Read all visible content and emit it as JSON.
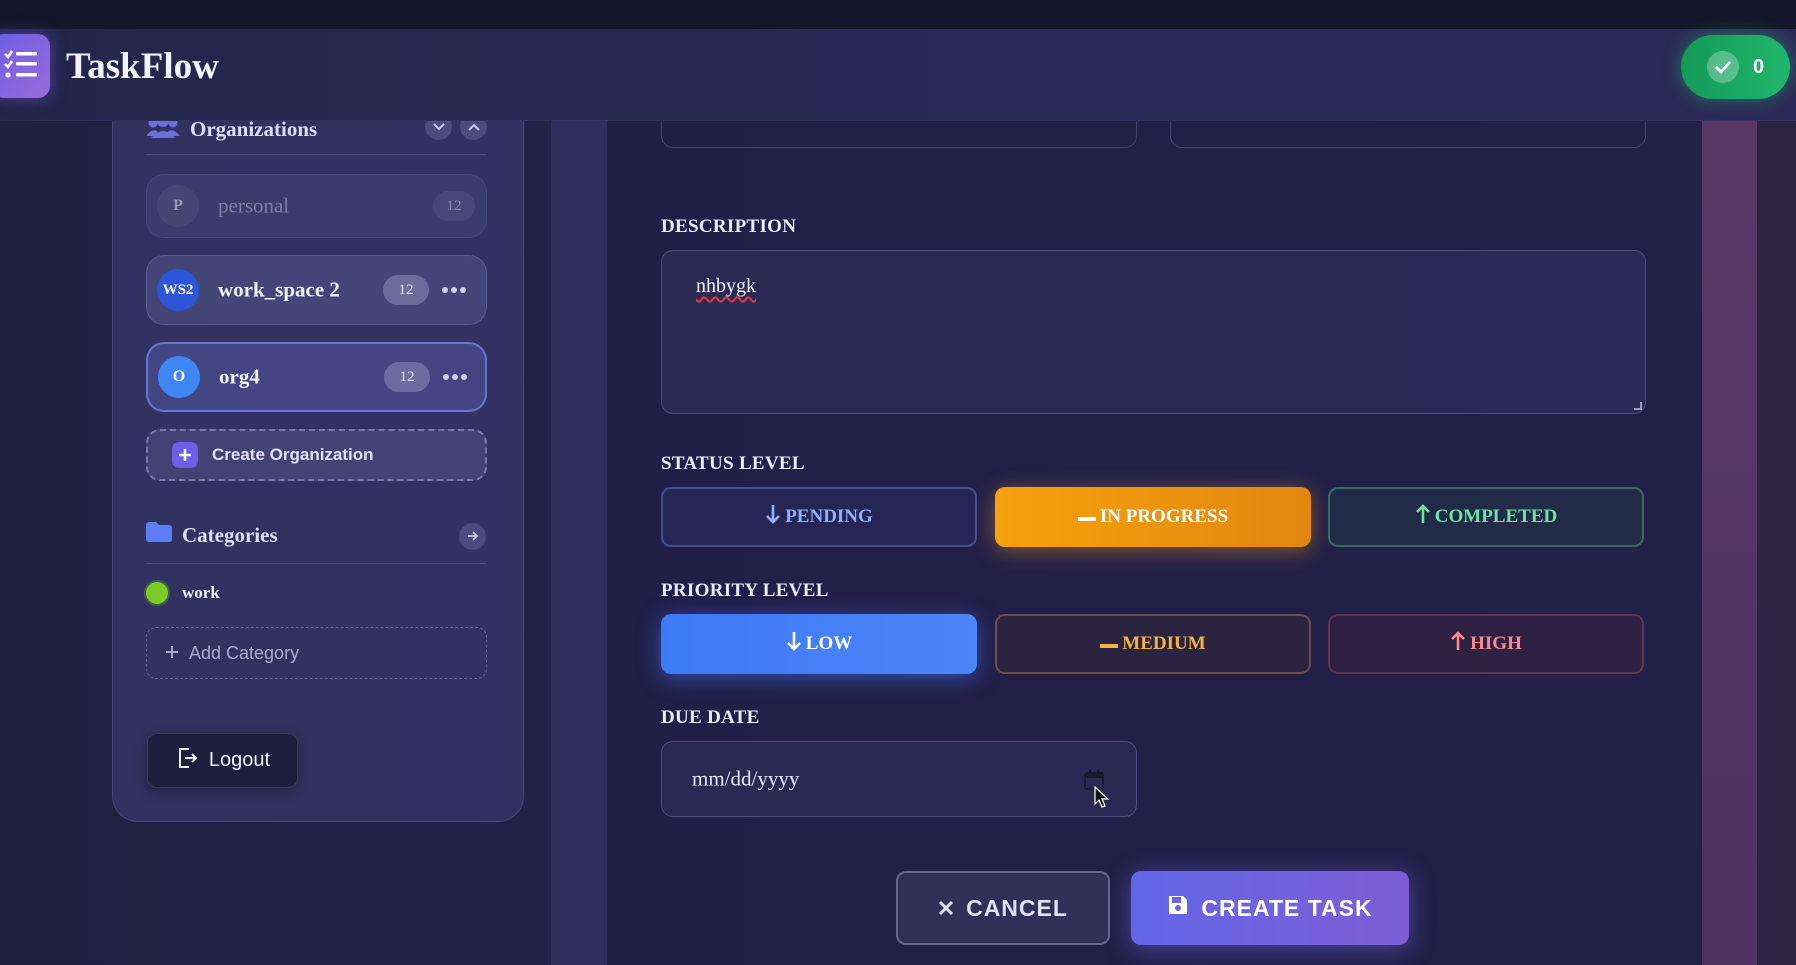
{
  "app": {
    "title": "TaskFlow",
    "completed_count": "0"
  },
  "sidebar": {
    "organizations_title": "Organizations",
    "organizations": [
      {
        "initials": "P",
        "name": "personal",
        "count": "12",
        "avatar_color": "#5a5d86"
      },
      {
        "initials": "WS2",
        "name": "work_space 2",
        "count": "12",
        "avatar_color": "#2c55d8"
      },
      {
        "initials": "O",
        "name": "org4",
        "count": "12",
        "avatar_color": "#3d86f4"
      }
    ],
    "create_org_label": "Create Organization",
    "categories_title": "Categories",
    "categories": [
      {
        "name": "work",
        "color": "#7acb24"
      }
    ],
    "add_category_label": "Add Category",
    "logout_label": "Logout"
  },
  "form": {
    "description_label": "DESCRIPTION",
    "description_value": "nhbygk",
    "status_label": "STATUS LEVEL",
    "status_options": [
      "PENDING",
      "IN PROGRESS",
      "COMPLETED"
    ],
    "status_selected": "IN PROGRESS",
    "priority_label": "PRIORITY LEVEL",
    "priority_options": [
      "LOW",
      "MEDIUM",
      "HIGH"
    ],
    "priority_selected": "LOW",
    "due_date_label": "DUE DATE",
    "due_date_placeholder": "mm/dd/yyyy",
    "cancel_label": "CANCEL",
    "create_label": "CREATE TASK"
  },
  "colors": {
    "accent": "#6c5ee6",
    "in_progress": "#f5a20e",
    "low": "#3d7bf6",
    "completed": "#6fe3a1",
    "medium": "#f3b440",
    "high": "#ff8a8a",
    "counter": "#1fb56c"
  }
}
